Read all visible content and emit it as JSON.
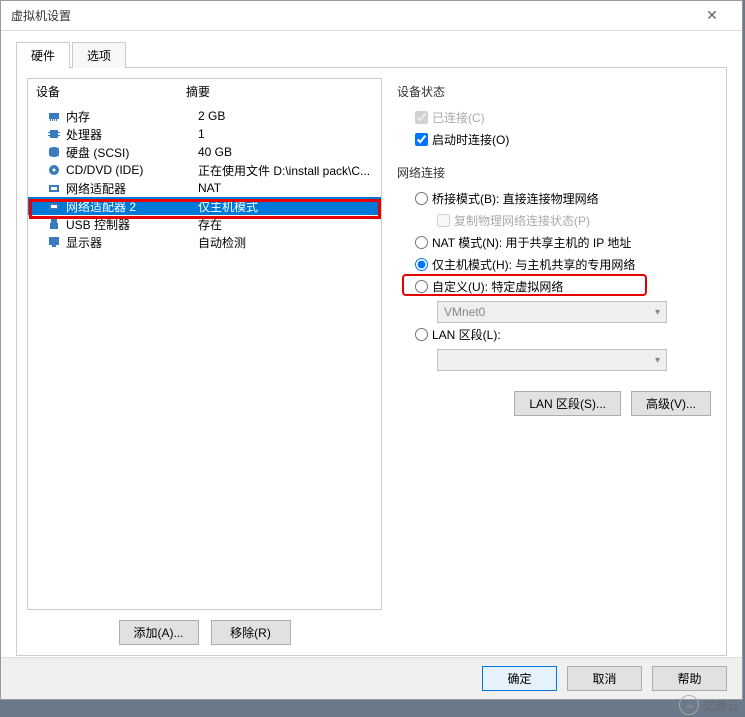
{
  "title": "虚拟机设置",
  "tabs": {
    "hardware": "硬件",
    "options": "选项"
  },
  "list": {
    "col1": "设备",
    "col2": "摘要",
    "rows": [
      {
        "name": "内存",
        "summary": "2 GB",
        "icon": "memory"
      },
      {
        "name": "处理器",
        "summary": "1",
        "icon": "cpu"
      },
      {
        "name": "硬盘 (SCSI)",
        "summary": "40 GB",
        "icon": "disk"
      },
      {
        "name": "CD/DVD (IDE)",
        "summary": "正在使用文件 D:\\install pack\\C...",
        "icon": "cd"
      },
      {
        "name": "网络适配器",
        "summary": "NAT",
        "icon": "nic"
      },
      {
        "name": "网络适配器 2",
        "summary": "仅主机模式",
        "icon": "nic"
      },
      {
        "name": "USB 控制器",
        "summary": "存在",
        "icon": "usb"
      },
      {
        "name": "显示器",
        "summary": "自动检测",
        "icon": "display"
      }
    ]
  },
  "buttons": {
    "add": "添加(A)...",
    "remove": "移除(R)"
  },
  "right": {
    "status_title": "设备状态",
    "connected": "已连接(C)",
    "connect_at_poweron": "启动时连接(O)",
    "net_title": "网络连接",
    "bridged": "桥接模式(B): 直接连接物理网络",
    "replicate": "复制物理网络连接状态(P)",
    "nat": "NAT 模式(N): 用于共享主机的 IP 地址",
    "hostonly": "仅主机模式(H): 与主机共享的专用网络",
    "custom": "自定义(U): 特定虚拟网络",
    "vmnet": "VMnet0",
    "lan_segment": "LAN 区段(L):",
    "lan_seg_btn": "LAN 区段(S)...",
    "advanced_btn": "高级(V)..."
  },
  "footer": {
    "ok": "确定",
    "cancel": "取消",
    "help": "帮助"
  },
  "watermark": "亿速云"
}
